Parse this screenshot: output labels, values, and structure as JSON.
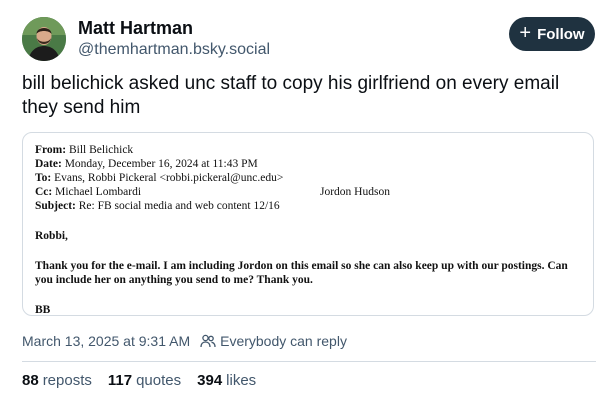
{
  "author": {
    "name": "Matt Hartman",
    "handle": "@themhartman.bsky.social"
  },
  "follow_button": {
    "icon": "plus-icon",
    "label": "Follow"
  },
  "post": {
    "text": "bill belichick asked unc staff to copy his girlfriend on every email they send him"
  },
  "email": {
    "from_label": "From:",
    "from_value": " Bill Belichick",
    "date_label": "Date:",
    "date_value": " Monday, December 16, 2024 at 11:43 PM",
    "to_label": "To:",
    "to_value": " Evans, Robbi Pickeral <robbi.pickeral@unc.edu>",
    "cc_label": "Cc:",
    "cc_value": " Michael Lombardi",
    "cc_value2": "Jordon Hudson",
    "subject_label": "Subject:",
    "subject_value": " Re: FB social media and web content 12/16",
    "greeting": "Robbi,",
    "body": "Thank you for the e-mail.  I am including Jordon on this email so she can also keep up with our postings.  Can you include her on anything you send to me?  Thank you.",
    "signoff": "BB"
  },
  "meta": {
    "timestamp": "March 13, 2025 at 9:31 AM",
    "reply_icon": "people-icon",
    "reply_setting": "Everybody can reply"
  },
  "stats": {
    "reposts_count": "88",
    "reposts_label": "reposts",
    "quotes_count": "117",
    "quotes_label": "quotes",
    "likes_count": "394",
    "likes_label": "likes"
  },
  "colors": {
    "follow_bg": "#1f3240",
    "muted_text": "#42576c",
    "border": "#d4dbe2"
  }
}
